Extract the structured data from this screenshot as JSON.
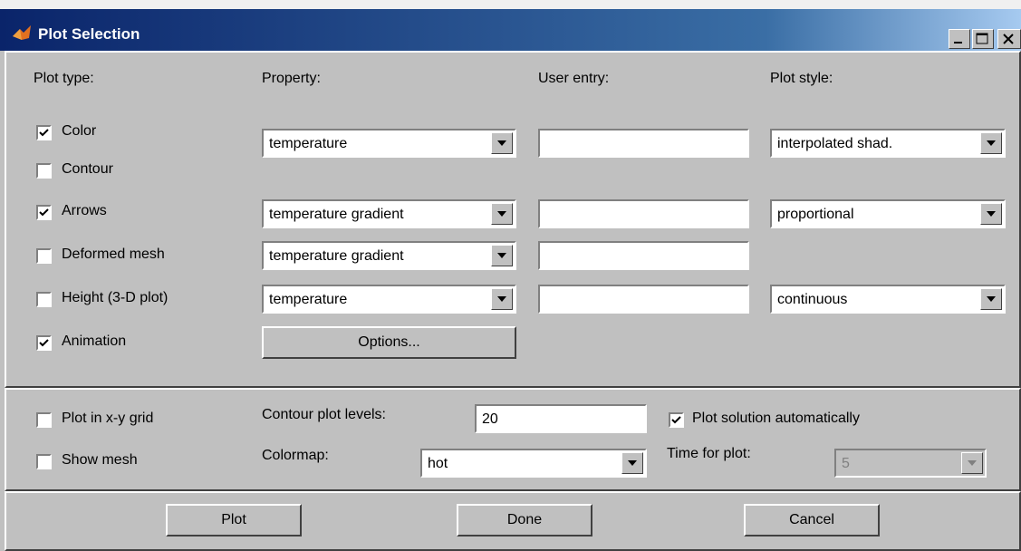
{
  "window": {
    "title": "Plot Selection",
    "controls": [
      "minimize-icon",
      "maximize-icon",
      "close-icon"
    ]
  },
  "headers": {
    "plot_type": "Plot type:",
    "property": "Property:",
    "user_entry": "User entry:",
    "plot_style": "Plot style:"
  },
  "plot_rows": [
    {
      "label": "Color",
      "checked": true,
      "property": "temperature",
      "user_entry": "",
      "style": "interpolated shad."
    },
    {
      "label": "Contour",
      "checked": false
    },
    {
      "label": "Arrows",
      "checked": true,
      "property": "temperature gradient",
      "user_entry": "",
      "style": "proportional"
    },
    {
      "label": "Deformed mesh",
      "checked": false,
      "property": "temperature gradient",
      "user_entry": ""
    },
    {
      "label": "Height (3-D plot)",
      "checked": false,
      "property": "temperature",
      "user_entry": "",
      "style": "continuous"
    },
    {
      "label": "Animation",
      "checked": true,
      "button": "Options..."
    }
  ],
  "options2": {
    "plot_grid": {
      "label": "Plot in x-y grid",
      "checked": false
    },
    "show_mesh": {
      "label": "Show mesh",
      "checked": false
    },
    "contour_levels_label": "Contour plot levels:",
    "contour_levels_value": "20",
    "colormap_label": "Colormap:",
    "colormap_value": "hot",
    "plot_auto": {
      "label": "Plot solution automatically",
      "checked": true
    },
    "time_label": "Time for plot:",
    "time_value": "5"
  },
  "buttons": {
    "plot": "Plot",
    "done": "Done",
    "cancel": "Cancel"
  },
  "colors": {
    "titlebar_start": "#0a246a",
    "titlebar_end": "#a6caf0",
    "face": "#c0c0c0"
  }
}
